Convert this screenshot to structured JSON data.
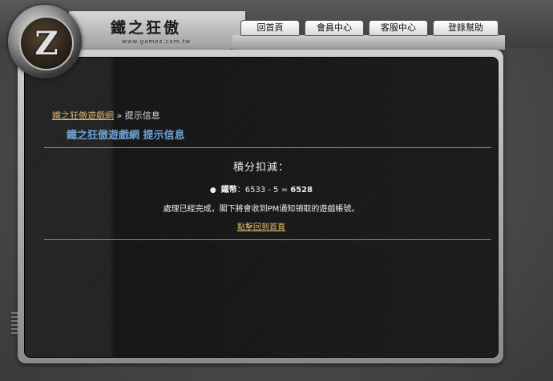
{
  "brand": {
    "logo_glyph": "Z",
    "site_title": "鐵之狂傲",
    "site_url": "www.gamez.com.tw"
  },
  "nav": {
    "items": [
      {
        "label": "回首頁"
      },
      {
        "label": "會員中心"
      },
      {
        "label": "客服中心"
      },
      {
        "label": "登錄幫助"
      }
    ]
  },
  "breadcrumb": {
    "link": "鐵之狂傲遊戲網",
    "separator": "»",
    "current": "提示信息"
  },
  "heading": "鐵之狂傲遊戲網 提示信息",
  "message": {
    "title": "積分扣減：",
    "bullet": "●",
    "currency_label": "鐵幣",
    "calculation": "：6533 - 5 =",
    "result": "6528",
    "notice": "處理已經完成，閣下將會收到PM通知領取的遊戲帳號。",
    "home_link": "點擊回到首頁"
  },
  "colors": {
    "link": "#d8b070",
    "heading": "#6fa2d6"
  }
}
